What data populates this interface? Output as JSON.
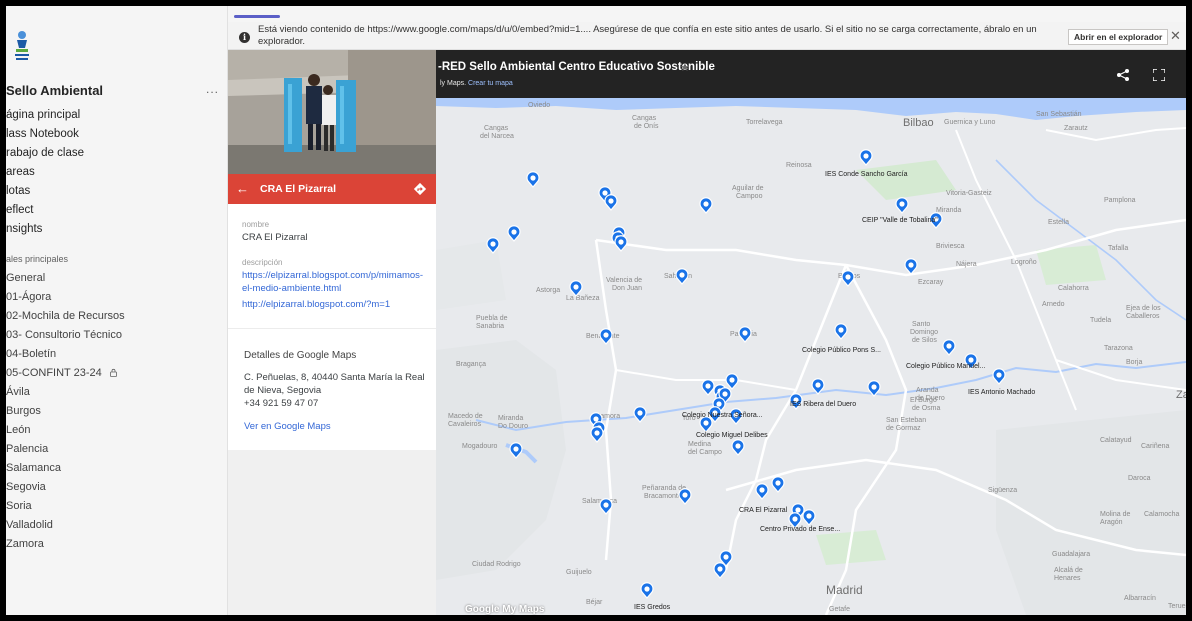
{
  "sidebar": {
    "team_title": "Sello Ambiental",
    "more_label": "...",
    "nav_items": [
      {
        "label": "ágina principal"
      },
      {
        "label": "lass Notebook"
      },
      {
        "label": "rabajo de clase"
      },
      {
        "label": "areas"
      },
      {
        "label": "lotas"
      },
      {
        "label": "eflect"
      },
      {
        "label": "nsights"
      }
    ],
    "section_label": "ales principales",
    "channels": [
      {
        "label": "General"
      },
      {
        "label": "01-Ágora"
      },
      {
        "label": "02-Mochila de Recursos"
      },
      {
        "label": "03- Consultorio Técnico"
      },
      {
        "label": "04-Boletín"
      },
      {
        "label": "05-CONFINT 23-24"
      },
      {
        "label": "Ávila"
      },
      {
        "label": "Burgos"
      },
      {
        "label": "León"
      },
      {
        "label": "Palencia"
      },
      {
        "label": "Salamanca"
      },
      {
        "label": "Segovia"
      },
      {
        "label": "Soria"
      },
      {
        "label": "Valladolid"
      },
      {
        "label": "Zamora"
      }
    ]
  },
  "infobar": {
    "text": "Está viendo contenido de https://www.google.com/maps/d/u/0/embed?mid=1.... Asegúrese de que confía en este sitio antes de usarlo. Si el sitio no se carga correctamente, ábralo en un explorador.",
    "open_button": "Abrir en el explorador",
    "close": "✕"
  },
  "map": {
    "title": "-RED Sello Ambiental Centro Educativo Sostenible",
    "subtitle_prefix": "ly Maps.",
    "subtitle_link": "Crear tu mapa",
    "google_logo": "Google My Maps",
    "school_labels": [
      "IES Conde Sancho García",
      "CEIP \"Valle de Tobalina\"",
      "Colegio Público Pons S...",
      "Colegio Público Manuel...",
      "IES Antonio Machado",
      "IES Ribera del Duero",
      "Colegio Nuestra Señora...",
      "Colegio Miguel Delibes",
      "CRA El Pizarral",
      "Centro Privado de Ense...",
      "IES Gredos"
    ],
    "place_labels": [
      "Oviedo",
      "Cangas de Onís",
      "Cangas del Narcea",
      "Bilbao",
      "Guernica y Luno",
      "San Sebastián",
      "Zarautz",
      "Torrelavega",
      "Reinosa",
      "Aguilar de Campoo",
      "Vitoria-Gasteiz",
      "Pamplona",
      "Miranda de Ebro",
      "Estella",
      "Tafalla",
      "Briviesca",
      "Logroño",
      "Nájera",
      "Ezcaray",
      "Calahorra",
      "Arnedo",
      "Ejea de los Caballeros",
      "Tudela",
      "Astorga",
      "Valencia de Don Juan",
      "Sahagún",
      "La Bañeza",
      "Benavente",
      "Palencia",
      "Burgos",
      "Santo Domingo de Silos",
      "Puebla de Sanabria",
      "Bragança",
      "Aranda de Duero",
      "El Burgo de Osma",
      "San Esteban de Gormaz",
      "Tarazona",
      "Borja",
      "Zamora",
      "Toro",
      "Medina del Campo",
      "Macedo de Cavaleiros",
      "Miranda do Douro",
      "Mogadouro",
      "Calatayud",
      "Cariñena",
      "Daroca",
      "Sigüenza",
      "Molina de Aragón",
      "Calamocha",
      "Salamanca",
      "Peñaranda de Bracamonte",
      "Ciudad Rodrigo",
      "Guijuelo",
      "Béjar",
      "Guadalajara",
      "Alcalá de Henares",
      "Madrid",
      "Getafe",
      "Albarracín",
      "Teruel"
    ]
  },
  "panel": {
    "back_icon": "←",
    "place_name": "CRA El Pizarral",
    "nombre_label": "nombre",
    "nombre_value": "CRA El Pizarral",
    "descripcion_label": "descripción",
    "descripcion_link1": "https://elpizarral.blogspot.com/p/mimamos-el-medio-ambiente.html",
    "descripcion_link2": "http://elpizarral.blogspot.com/?m=1",
    "gm_title": "Detalles de Google Maps",
    "gm_address": "C. Peñuelas, 8, 40440 Santa María la Real de Nieva, Segovia",
    "gm_phone": "+34 921 59 47 07",
    "gm_link": "Ver en Google Maps"
  },
  "colors": {
    "accent": "#5b5fc7",
    "panel_bar": "#db4437",
    "pin": "#1a73e8",
    "map_header": "#232323"
  }
}
